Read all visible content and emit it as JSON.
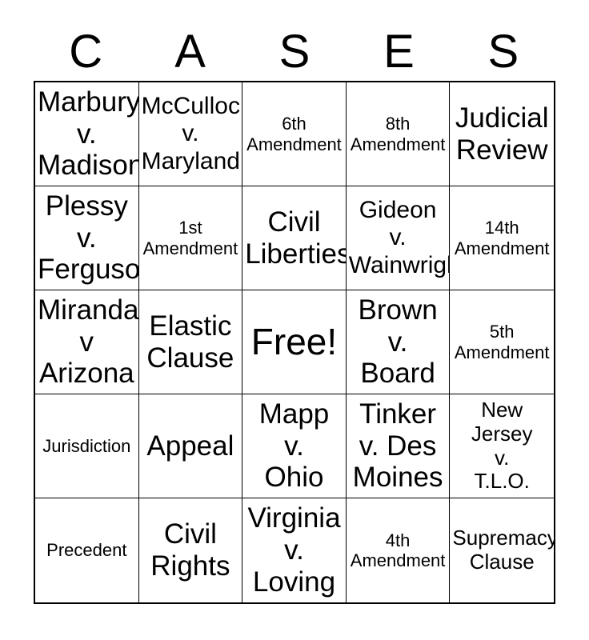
{
  "card": {
    "title_letters": [
      "C",
      "A",
      "S",
      "E",
      "S"
    ],
    "free_space_label": "Free!",
    "colors": {
      "background": "#ffffff",
      "text": "#000000",
      "border": "#000000"
    },
    "grid": {
      "rows": 5,
      "columns": 5
    },
    "cells": [
      {
        "text": "Marbury\nv.\nMadison",
        "size": "fs-lg"
      },
      {
        "text": "McCulloch\nv.\nMaryland",
        "size": "fs-md"
      },
      {
        "text": "6th\nAmendment",
        "size": "fs-xs"
      },
      {
        "text": "8th\nAmendment",
        "size": "fs-xs"
      },
      {
        "text": "Judicial\nReview",
        "size": "fs-lg"
      },
      {
        "text": "Plessy\nv.\nFerguson",
        "size": "fs-lg"
      },
      {
        "text": "1st\nAmendment",
        "size": "fs-xs"
      },
      {
        "text": "Civil\nLiberties",
        "size": "fs-lg"
      },
      {
        "text": "Gideon\nv.\nWainwright",
        "size": "fs-md"
      },
      {
        "text": "14th\nAmendment",
        "size": "fs-xs"
      },
      {
        "text": "Miranda\nv\nArizona",
        "size": "fs-lg"
      },
      {
        "text": "Elastic\nClause",
        "size": "fs-lg"
      },
      {
        "text": "Free!",
        "size": "fs-xl"
      },
      {
        "text": "Brown\nv.\nBoard",
        "size": "fs-lg"
      },
      {
        "text": "5th\nAmendment",
        "size": "fs-xs"
      },
      {
        "text": "Jurisdiction",
        "size": "fs-xs"
      },
      {
        "text": "Appeal",
        "size": "fs-lg"
      },
      {
        "text": "Mapp\nv.\nOhio",
        "size": "fs-lg"
      },
      {
        "text": "Tinker\nv. Des\nMoines",
        "size": "fs-lg"
      },
      {
        "text": "New\nJersey\nv.\nT.L.O.",
        "size": "fs-sm"
      },
      {
        "text": "Precedent",
        "size": "fs-xs"
      },
      {
        "text": "Civil\nRights",
        "size": "fs-lg"
      },
      {
        "text": "Virginia\nv.\nLoving",
        "size": "fs-lg"
      },
      {
        "text": "4th\nAmendment",
        "size": "fs-xs"
      },
      {
        "text": "Supremacy\nClause",
        "size": "fs-sm"
      }
    ]
  }
}
